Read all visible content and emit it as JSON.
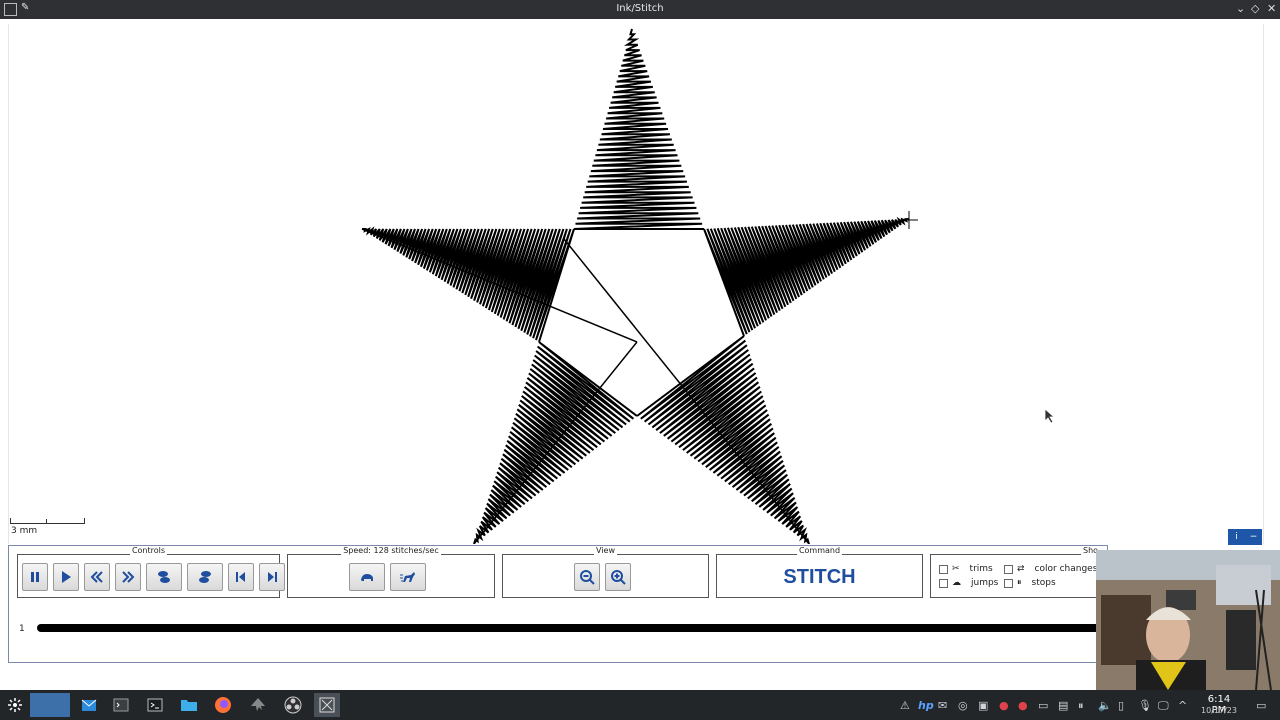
{
  "window": {
    "title": "Ink/Stitch"
  },
  "canvas": {
    "scale_label": "3 mm"
  },
  "info_buttons": [
    "i",
    "−"
  ],
  "controls": {
    "label": "Controls",
    "buttons": [
      "pause-icon",
      "play-icon",
      "step-backward-icon",
      "step-forward-icon",
      "prev-command-icon",
      "next-command-icon",
      "skip-to-start-icon",
      "skip-to-end-icon"
    ]
  },
  "speed": {
    "label": "Speed: 128 stitches/sec",
    "buttons": [
      "slower-icon",
      "faster-icon"
    ]
  },
  "view": {
    "label": "View",
    "buttons": [
      "zoom-out-icon",
      "zoom-in-icon"
    ]
  },
  "command": {
    "label": "Command",
    "value": "STITCH"
  },
  "show": {
    "label": "Sho",
    "options": [
      {
        "label": "trims",
        "icon": "scissors-icon",
        "checked": false
      },
      {
        "label": "color changes",
        "icon": "swap-icon",
        "checked": false
      },
      {
        "label": "jumps",
        "icon": "jump-icon",
        "checked": false
      },
      {
        "label": "stops",
        "icon": "pause-small-icon",
        "checked": false
      }
    ]
  },
  "progress": {
    "color_index": "1",
    "fraction": 1.0
  },
  "taskbar": {
    "clock_time": "6:14 PM",
    "clock_date": "10/17/23",
    "apps": [
      "launcher-icon",
      "desktop-pager-icon",
      "mail-icon",
      "terminal-icon",
      "konsole-icon",
      "file-manager-icon",
      "firefox-icon",
      "inkscape-icon",
      "obs-icon",
      "inkstitch-icon"
    ]
  },
  "colors": {
    "accent": "#1f4e9e",
    "titlebar": "#2f3033",
    "taskbar": "#232629"
  }
}
